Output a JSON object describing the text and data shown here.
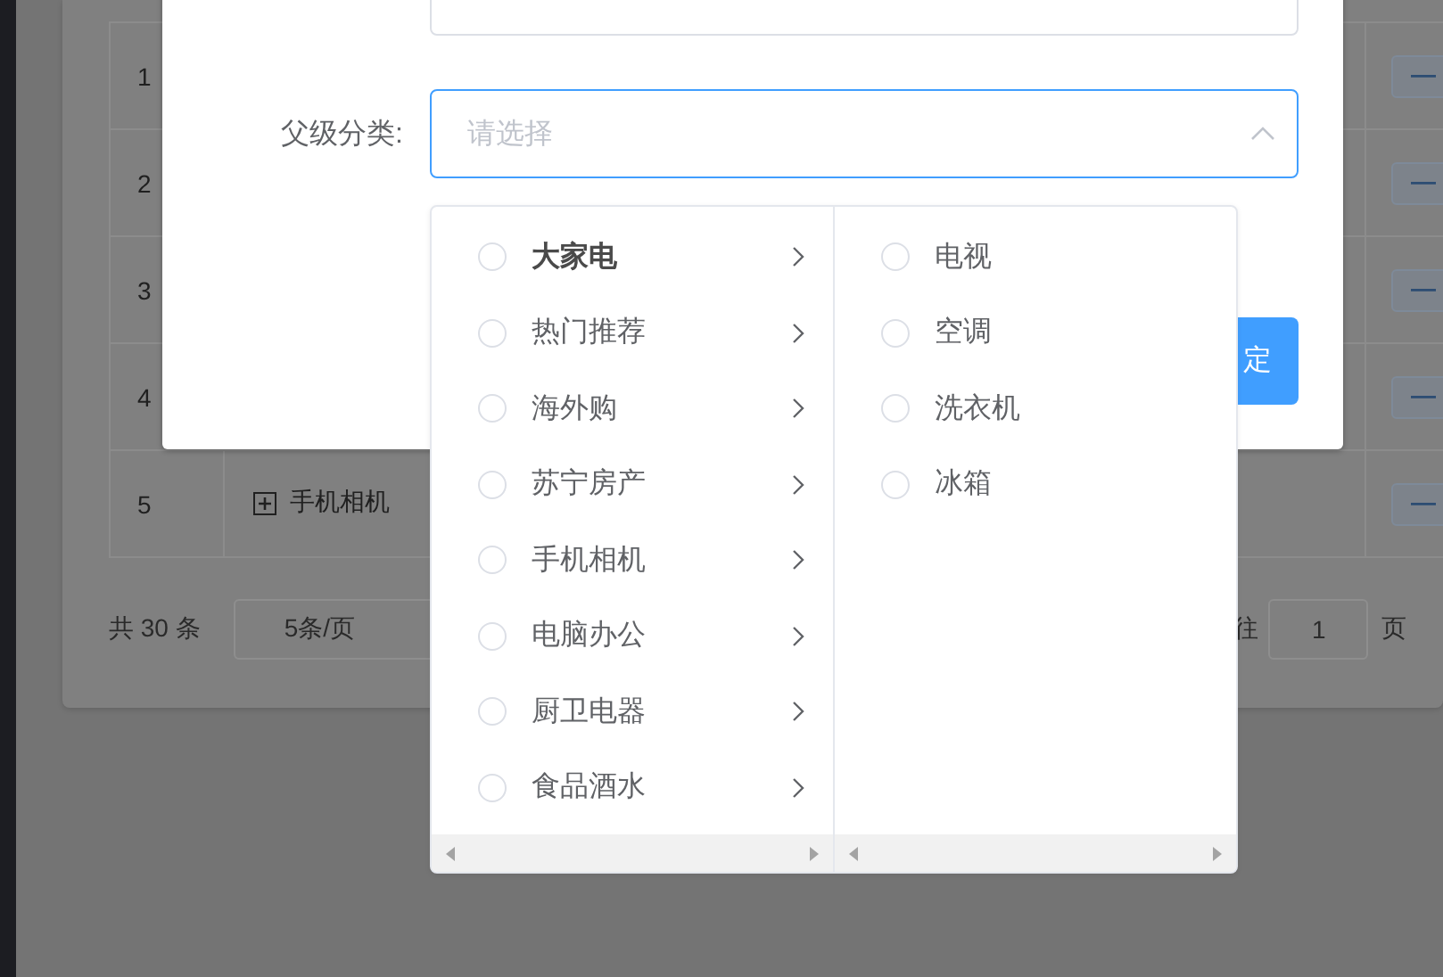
{
  "table": {
    "rows": [
      {
        "index": "1"
      },
      {
        "index": "2"
      },
      {
        "index": "3"
      },
      {
        "index": "4"
      },
      {
        "index": "5",
        "name": "手机相机",
        "expandable": true
      }
    ]
  },
  "pagination": {
    "total": "共 30 条",
    "page_size": "5条/页",
    "goto_label": "往",
    "page": "1",
    "page_suffix": "页"
  },
  "dialog": {
    "parent_label": "父级分类:",
    "parent_select": {
      "placeholder": "请选择",
      "open": true
    },
    "confirm_button": "定"
  },
  "cascader": {
    "columns": [
      {
        "items": [
          {
            "label": "大家电",
            "checked": false,
            "active": true,
            "has_children": true
          },
          {
            "label": "热门推荐",
            "checked": false,
            "active": false,
            "has_children": true
          },
          {
            "label": "海外购",
            "checked": false,
            "active": false,
            "has_children": true
          },
          {
            "label": "苏宁房产",
            "checked": false,
            "active": false,
            "has_children": true
          },
          {
            "label": "手机相机",
            "checked": false,
            "active": false,
            "has_children": true
          },
          {
            "label": "电脑办公",
            "checked": false,
            "active": false,
            "has_children": true
          },
          {
            "label": "厨卫电器",
            "checked": false,
            "active": false,
            "has_children": true
          },
          {
            "label": "食品酒水",
            "checked": false,
            "active": false,
            "has_children": true
          }
        ]
      },
      {
        "items": [
          {
            "label": "电视",
            "checked": false,
            "active": false,
            "has_children": false
          },
          {
            "label": "空调",
            "checked": false,
            "active": false,
            "has_children": false
          },
          {
            "label": "洗衣机",
            "checked": false,
            "active": false,
            "has_children": false
          },
          {
            "label": "冰箱",
            "checked": false,
            "active": false,
            "has_children": false
          }
        ]
      }
    ]
  }
}
